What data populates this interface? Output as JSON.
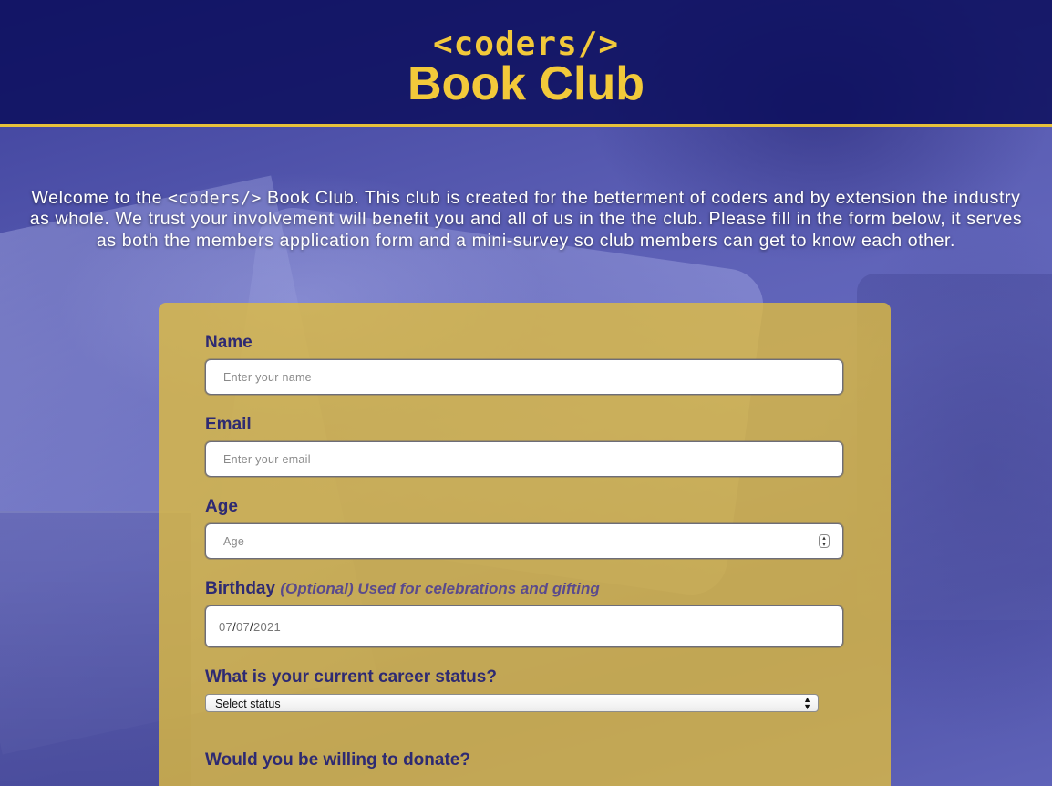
{
  "header": {
    "logo_code": "<coders/>",
    "logo_title": "Book Club"
  },
  "intro": {
    "part1": "Welcome to the ",
    "code": "<coders/>",
    "part2": " Book Club. This club is created for the betterment of coders and by extension the industry as whole. We trust your involvement will benefit you and all of us in the the club. Please fill in the form below, it serves as both the members application form and a mini-survey so club members can get to know each other."
  },
  "form": {
    "name": {
      "label": "Name",
      "placeholder": "Enter your name"
    },
    "email": {
      "label": "Email",
      "placeholder": "Enter your email"
    },
    "age": {
      "label": "Age",
      "placeholder": "Age"
    },
    "birthday": {
      "label": "Birthday",
      "hint": "(Optional) Used for celebrations and gifting",
      "month": "07",
      "day": "07",
      "year": "2021"
    },
    "career": {
      "label": "What is your current career status?",
      "selected": "Select status"
    },
    "donate": {
      "label": "Would you be willing to donate?"
    }
  },
  "colors": {
    "header_bg": "#0a0c5a",
    "accent": "#f2c93a",
    "form_bg": "#e1be3c",
    "label": "#2e2a72"
  }
}
